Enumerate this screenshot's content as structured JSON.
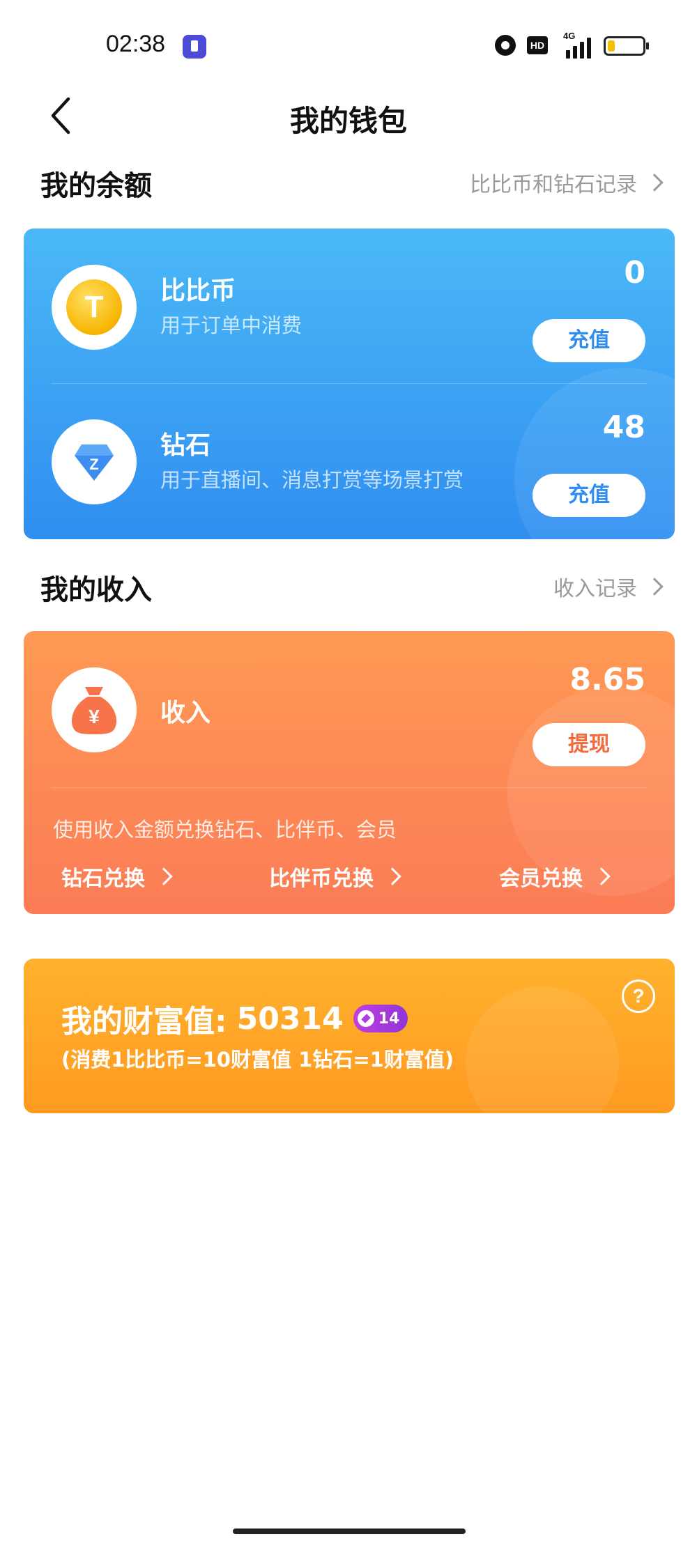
{
  "status_bar": {
    "time": "02:38",
    "hd_label": "HD",
    "network_label": "4G",
    "battery_level": 0.2,
    "battery_color": "#f2c200"
  },
  "nav": {
    "back_icon": "chevron-left-icon",
    "title": "我的钱包"
  },
  "balance_section": {
    "title": "我的余额",
    "link_label": "比比币和钻石记录",
    "rows": [
      {
        "icon": "coin-icon",
        "icon_glyph": "T",
        "title": "比比币",
        "subtitle": "用于订单中消费",
        "amount": "0",
        "button_label": "充值"
      },
      {
        "icon": "diamond-icon",
        "icon_glyph": "Z",
        "title": "钻石",
        "subtitle": "用于直播间、消息打赏等场景打赏",
        "amount": "48",
        "button_label": "充值"
      }
    ]
  },
  "income_section": {
    "title": "我的收入",
    "link_label": "收入记录",
    "card": {
      "icon": "money-bag-icon",
      "icon_glyph": "¥",
      "title": "收入",
      "amount": "8.65",
      "button_label": "提现",
      "note": "使用收入金额兑换钻石、比伴币、会员",
      "exchanges": [
        "钻石兑换",
        "比伴币兑换",
        "会员兑换"
      ]
    }
  },
  "wealth_card": {
    "label": "我的财富值:",
    "value": "50314",
    "badge_level": "14",
    "note": "(消费1比比币=10财富值 1钻石=1财富值)",
    "help_glyph": "?"
  },
  "colors": {
    "balance_card": "#3aa3f4",
    "income_card": "#fd8a55",
    "wealth_card": "#ffa627"
  }
}
